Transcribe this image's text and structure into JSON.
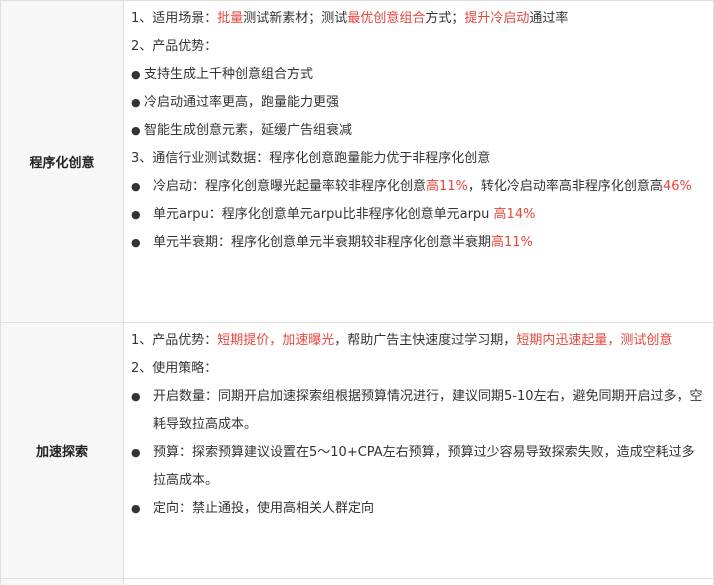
{
  "rows": [
    {
      "label": "程序化创意",
      "lines": [
        {
          "type": "plain",
          "parts": [
            {
              "t": "1、适用场景："
            },
            {
              "t": "批量",
              "red": true
            },
            {
              "t": "测试新素材；测试"
            },
            {
              "t": "最优创意组合",
              "red": true
            },
            {
              "t": "方式；"
            },
            {
              "t": "提升冷启动",
              "red": true
            },
            {
              "t": "通过率"
            }
          ]
        },
        {
          "type": "plain",
          "parts": [
            {
              "t": "2、产品优势："
            }
          ]
        },
        {
          "type": "dot",
          "parts": [
            {
              "t": "支持生成上千种创意组合方式"
            }
          ]
        },
        {
          "type": "dot",
          "parts": [
            {
              "t": "冷启动通过率更高，跑量能力更强"
            }
          ]
        },
        {
          "type": "dot",
          "parts": [
            {
              "t": "智能生成创意元素，延缓广告组衰减"
            }
          ]
        },
        {
          "type": "plain",
          "parts": [
            {
              "t": "3、通信行业测试数据：程序化创意跑量能力优于非程序化创意"
            }
          ]
        },
        {
          "type": "bullet",
          "parts": [
            {
              "t": "冷启动：程序化创意曝光起量率较非程序化创意"
            },
            {
              "t": "高11%",
              "red": true
            },
            {
              "t": "，转化冷启动率高非程序化创意高"
            },
            {
              "t": "46%",
              "red": true
            }
          ]
        },
        {
          "type": "bullet",
          "parts": [
            {
              "t": "单元arpu：程序化创意单元arpu比非程序化创意单元arpu  "
            },
            {
              "t": "高14%",
              "red": true
            }
          ]
        },
        {
          "type": "bullet",
          "parts": [
            {
              "t": "单元半衰期：程序化创意单元半衰期较非程序化创意半衰期"
            },
            {
              "t": "高11%",
              "red": true
            }
          ]
        }
      ]
    },
    {
      "label": "加速探索",
      "lines": [
        {
          "type": "plain",
          "parts": [
            {
              "t": "1、产品优势："
            },
            {
              "t": "短期提价，加速曝光",
              "red": true
            },
            {
              "t": "，帮助广告主快速度过学习期，"
            },
            {
              "t": "短期内迅速起量，测试创意",
              "red": true
            }
          ]
        },
        {
          "type": "plain",
          "parts": [
            {
              "t": "2、使用策略："
            }
          ]
        },
        {
          "type": "bullet",
          "parts": [
            {
              "t": "开启数量：同期开启加速探索组根据预算情况进行，建议同期5-10左右，避免同期开启过多，空耗导致拉高成本。"
            }
          ]
        },
        {
          "type": "bullet",
          "parts": [
            {
              "t": "预算：探索预算建议设置在5～10+CPA左右预算，预算过少容易导致探索失败，造成空耗过多拉高成本。"
            }
          ]
        },
        {
          "type": "bullet",
          "parts": [
            {
              "t": "定向：禁止通投，使用高相关人群定向"
            }
          ]
        }
      ]
    }
  ],
  "bullet_char": "●",
  "dot_char": "●"
}
